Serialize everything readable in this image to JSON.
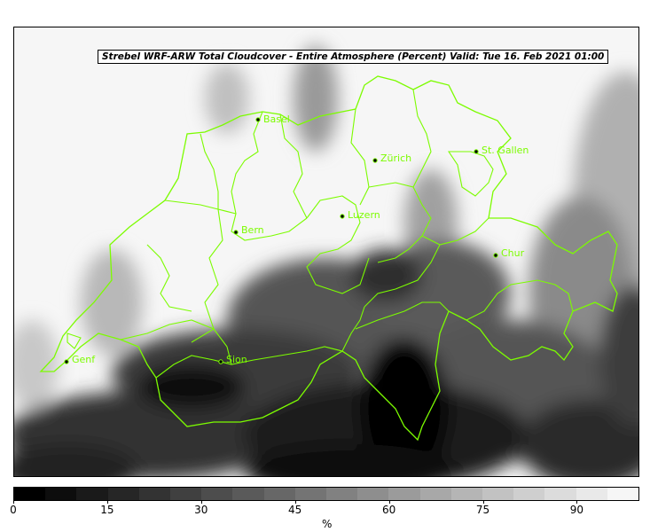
{
  "title": "Strebel WRF-ARW Total Cloudcover - Entire Atmosphere (Percent)   Valid: Tue 16. Feb 2021 01:00",
  "colorbar": {
    "unit": "%",
    "ticks": [
      "0",
      "15",
      "30",
      "45",
      "60",
      "75",
      "90"
    ],
    "colors": [
      "#000000",
      "#0d0d0d",
      "#1a1a1a",
      "#262626",
      "#333333",
      "#404040",
      "#4d4d4d",
      "#5a5a5a",
      "#676767",
      "#747474",
      "#818181",
      "#8e8e8e",
      "#9b9b9b",
      "#a8a8a8",
      "#b5b5b5",
      "#c2c2c2",
      "#cfcfcf",
      "#dcdcdc",
      "#e9e9e9",
      "#f6f6f6"
    ]
  },
  "cities": [
    {
      "name": "Basel"
    },
    {
      "name": "Zürich"
    },
    {
      "name": "St. Gallen"
    },
    {
      "name": "Luzern"
    },
    {
      "name": "Bern"
    },
    {
      "name": "Chur"
    },
    {
      "name": "Genf"
    },
    {
      "name": "Sion"
    }
  ],
  "border_color": "#7cfc00"
}
